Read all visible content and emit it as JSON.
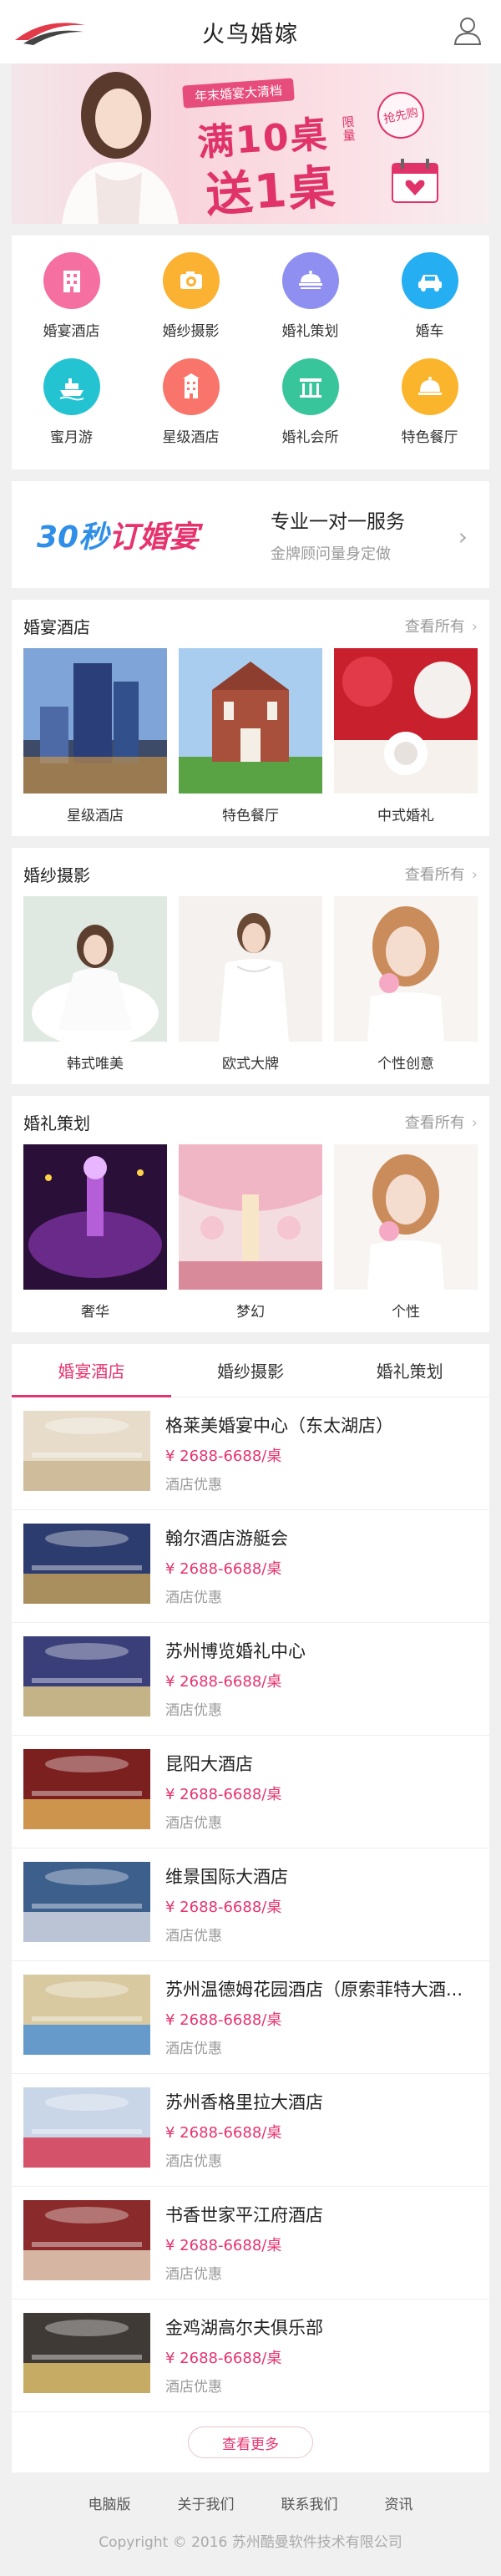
{
  "header": {
    "title": "火鸟婚嫁"
  },
  "banner": {
    "small_text": "年末婚宴大清档",
    "big_text_1": "满10桌",
    "limit_text": "限量",
    "big_text_2": "送1桌",
    "stamp_text": "抢先购"
  },
  "categories": [
    {
      "label": "婚宴酒店",
      "icon": "hotel-icon",
      "color": "#f56fa0"
    },
    {
      "label": "婚纱摄影",
      "icon": "camera-icon",
      "color": "#fbb233"
    },
    {
      "label": "婚礼策划",
      "icon": "planning-icon",
      "color": "#8e8ff0"
    },
    {
      "label": "婚车",
      "icon": "car-icon",
      "color": "#26aef2"
    },
    {
      "label": "蜜月游",
      "icon": "ship-icon",
      "color": "#24c3d1"
    },
    {
      "label": "星级酒店",
      "icon": "building-icon",
      "color": "#f9746a"
    },
    {
      "label": "婚礼会所",
      "icon": "club-icon",
      "color": "#38c59b"
    },
    {
      "label": "特色餐厅",
      "icon": "dining-icon",
      "color": "#fbb52c"
    }
  ],
  "promo": {
    "slogan_a": "30秒",
    "slogan_b": "订婚宴",
    "service_title": "专业一对一服务",
    "service_sub": "金牌顾问量身定做"
  },
  "galleries": [
    {
      "title": "婚宴酒店",
      "more": "查看所有",
      "items": [
        "星级酒店",
        "特色餐厅",
        "中式婚礼"
      ]
    },
    {
      "title": "婚纱摄影",
      "more": "查看所有",
      "items": [
        "韩式唯美",
        "欧式大牌",
        "个性创意"
      ]
    },
    {
      "title": "婚礼策划",
      "more": "查看所有",
      "items": [
        "奢华",
        "梦幻",
        "个性"
      ]
    }
  ],
  "tabs": [
    "婚宴酒店",
    "婚纱摄影",
    "婚礼策划"
  ],
  "active_tab": 0,
  "list": [
    {
      "name": "格莱美婚宴中心（东太湖店）",
      "price": "¥ 2688-6688/桌",
      "tag": "酒店优惠"
    },
    {
      "name": "翰尔酒店游艇会",
      "price": "¥ 2688-6688/桌",
      "tag": "酒店优惠"
    },
    {
      "name": "苏州博览婚礼中心",
      "price": "¥ 2688-6688/桌",
      "tag": "酒店优惠"
    },
    {
      "name": "昆阳大酒店",
      "price": "¥ 2688-6688/桌",
      "tag": "酒店优惠"
    },
    {
      "name": "维景国际大酒店",
      "price": "¥ 2688-6688/桌",
      "tag": "酒店优惠"
    },
    {
      "name": "苏州温德姆花园酒店（原索菲特大酒...",
      "price": "¥ 2688-6688/桌",
      "tag": "酒店优惠"
    },
    {
      "name": "苏州香格里拉大酒店",
      "price": "¥ 2688-6688/桌",
      "tag": "酒店优惠"
    },
    {
      "name": "书香世家平江府酒店",
      "price": "¥ 2688-6688/桌",
      "tag": "酒店优惠"
    },
    {
      "name": "金鸡湖高尔夫俱乐部",
      "price": "¥ 2688-6688/桌",
      "tag": "酒店优惠"
    }
  ],
  "more_button": "查看更多",
  "footer": {
    "links": [
      "电脑版",
      "关于我们",
      "联系我们",
      "资讯"
    ],
    "copyright": "Copyright © 2016 苏州酷曼软件技术有限公司"
  }
}
